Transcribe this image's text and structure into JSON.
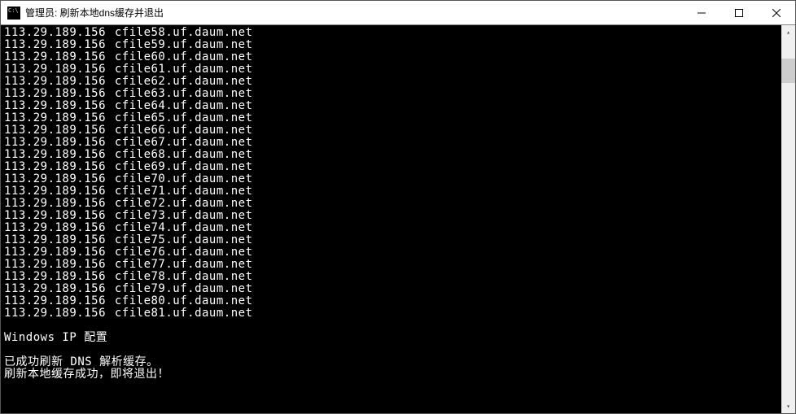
{
  "window": {
    "title": "管理员: 刷新本地dns缓存并退出"
  },
  "terminal": {
    "entries": [
      {
        "ip": "113.29.189.156",
        "host": "cfile58.uf.daum.net"
      },
      {
        "ip": "113.29.189.156",
        "host": "cfile59.uf.daum.net"
      },
      {
        "ip": "113.29.189.156",
        "host": "cfile60.uf.daum.net"
      },
      {
        "ip": "113.29.189.156",
        "host": "cfile61.uf.daum.net"
      },
      {
        "ip": "113.29.189.156",
        "host": "cfile62.uf.daum.net"
      },
      {
        "ip": "113.29.189.156",
        "host": "cfile63.uf.daum.net"
      },
      {
        "ip": "113.29.189.156",
        "host": "cfile64.uf.daum.net"
      },
      {
        "ip": "113.29.189.156",
        "host": "cfile65.uf.daum.net"
      },
      {
        "ip": "113.29.189.156",
        "host": "cfile66.uf.daum.net"
      },
      {
        "ip": "113.29.189.156",
        "host": "cfile67.uf.daum.net"
      },
      {
        "ip": "113.29.189.156",
        "host": "cfile68.uf.daum.net"
      },
      {
        "ip": "113.29.189.156",
        "host": "cfile69.uf.daum.net"
      },
      {
        "ip": "113.29.189.156",
        "host": "cfile70.uf.daum.net"
      },
      {
        "ip": "113.29.189.156",
        "host": "cfile71.uf.daum.net"
      },
      {
        "ip": "113.29.189.156",
        "host": "cfile72.uf.daum.net"
      },
      {
        "ip": "113.29.189.156",
        "host": "cfile73.uf.daum.net"
      },
      {
        "ip": "113.29.189.156",
        "host": "cfile74.uf.daum.net"
      },
      {
        "ip": "113.29.189.156",
        "host": "cfile75.uf.daum.net"
      },
      {
        "ip": "113.29.189.156",
        "host": "cfile76.uf.daum.net"
      },
      {
        "ip": "113.29.189.156",
        "host": "cfile77.uf.daum.net"
      },
      {
        "ip": "113.29.189.156",
        "host": "cfile78.uf.daum.net"
      },
      {
        "ip": "113.29.189.156",
        "host": "cfile79.uf.daum.net"
      },
      {
        "ip": "113.29.189.156",
        "host": "cfile80.uf.daum.net"
      },
      {
        "ip": "113.29.189.156",
        "host": "cfile81.uf.daum.net"
      }
    ],
    "footer1": "Windows IP 配置",
    "footer2": "已成功刷新 DNS 解析缓存。",
    "footer3": "刷新本地缓存成功，即将退出！"
  }
}
